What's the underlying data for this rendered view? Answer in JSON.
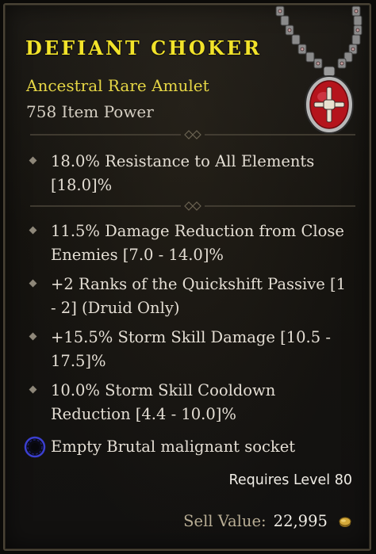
{
  "item": {
    "name": "DEFIANT CHOKER",
    "type": "Ancestral Rare Amulet",
    "power": "758 Item Power"
  },
  "implicits": [
    {
      "line1": "18.0% Resistance to All Elements",
      "line2": "[18.0]%"
    }
  ],
  "affixes": [
    {
      "line1": "11.5% Damage Reduction from Close",
      "line2": "Enemies [7.0 - 14.0]%"
    },
    {
      "line1": "+2 Ranks of the Quickshift Passive [1",
      "line2": "- 2] (Druid Only)"
    },
    {
      "line1": "+15.5% Storm Skill Damage [10.5 -",
      "line2": "17.5]%"
    },
    {
      "line1": "10.0% Storm Skill Cooldown",
      "line2": "Reduction [4.4 - 10.0]%"
    }
  ],
  "socket": {
    "label": "Empty Brutal malignant socket",
    "icon": "malignant-socket-icon"
  },
  "requirements": {
    "level_text": "Requires Level 80"
  },
  "sell": {
    "label": "Sell Value:",
    "value": "22,995",
    "icon": "gold-coin-icon"
  },
  "colors": {
    "name": "#f2e32a",
    "rarity": "#e6d645",
    "text": "#e4ded4",
    "socket_ring": "#3b3fd0",
    "amulet_gem": "#b5141c"
  }
}
